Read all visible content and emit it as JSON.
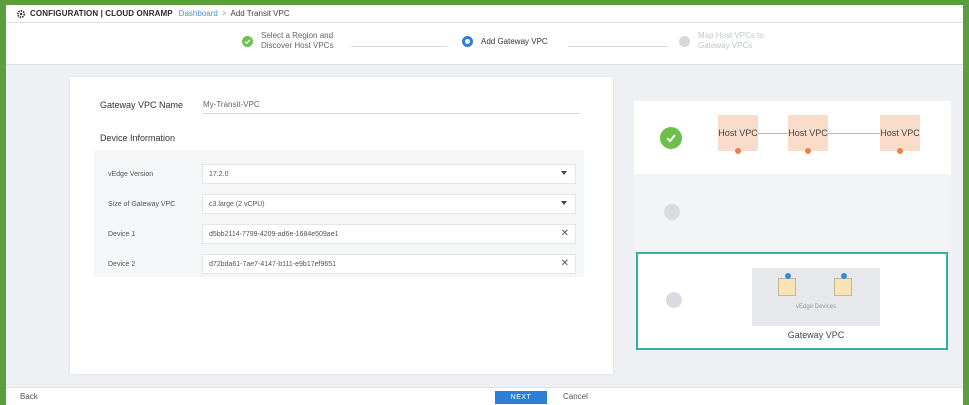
{
  "header": {
    "title": "CONFIGURATION | CLOUD ONRAMP",
    "breadcrumb_link": "Dashboard",
    "breadcrumb_sep": ">",
    "breadcrumb_current": "Add Transit VPC"
  },
  "stepper": {
    "steps": [
      {
        "label": "Select a Region and Discover Host VPCs",
        "state": "done"
      },
      {
        "label": "Add Gateway VPC",
        "state": "active"
      },
      {
        "label": "Map Host VPCs to Gateway VPCs",
        "state": "pending"
      }
    ]
  },
  "form": {
    "gateway_vpc_name_label": "Gateway VPC Name",
    "gateway_vpc_name_value": "My-Transit-VPC",
    "device_info_title": "Device Information",
    "fields": [
      {
        "label": "vEdge Version",
        "value": "17.2.0",
        "control": "dropdown"
      },
      {
        "label": "Size of Gateway VPC",
        "value": "c3.large (2 vCPU)",
        "control": "dropdown"
      },
      {
        "label": "Device 1",
        "value": "d5bb2114-7799-4209-ad6e-1684e509ae1",
        "control": "clear"
      },
      {
        "label": "Device 2",
        "value": "d72bda61-7ae7-4147-b111-e9b17ef9651",
        "control": "clear"
      }
    ]
  },
  "diagram": {
    "host_vpcs": [
      {
        "label": "Host VPC"
      },
      {
        "label": "Host VPC"
      },
      {
        "label": "Host VPC"
      }
    ],
    "gateway_sub_label": "vEdge Devices",
    "gateway_title": "Gateway VPC"
  },
  "footer": {
    "back_label": "Back",
    "next_label": "NEXT",
    "cancel_label": "Cancel"
  },
  "colors": {
    "accent": "#2c7fd6",
    "success": "#6cc04a",
    "host_vpc_bg": "#f9dcc9",
    "gateway_border": "#34b0a0",
    "outer_frame": "#5b9e3e"
  }
}
